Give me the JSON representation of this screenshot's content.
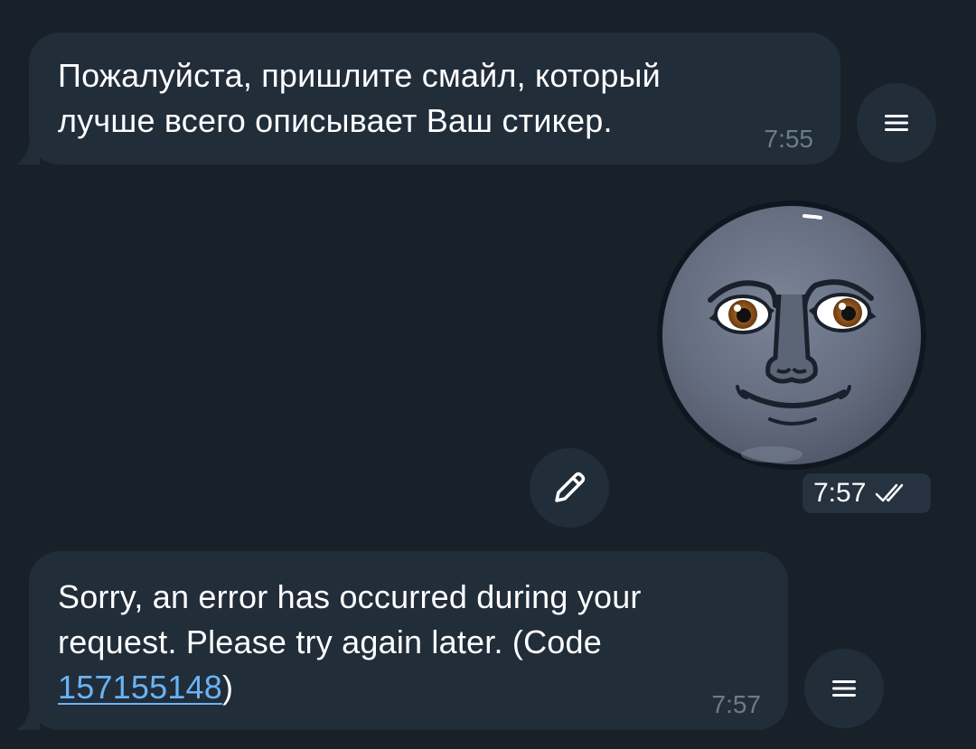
{
  "messages": [
    {
      "text": "Пожалуйста, пришлите смайл, который\nлучше всего описывает Ваш стикер.",
      "time": "7:55"
    },
    {
      "sticker": "new-moon-face-sticker",
      "time": "7:57",
      "status": "read"
    },
    {
      "text_before": "Sorry, an error has occurred during your\nrequest. Please try again later. (Code\n",
      "code": "157155148",
      "text_after": ")",
      "time": "7:57"
    }
  ],
  "icons": {
    "menu": "menu-icon",
    "edit": "pencil-icon",
    "read_status": "double-check-icon"
  },
  "colors": {
    "background": "#182029",
    "bubble": "#222d3a",
    "link": "#6ab3f3"
  }
}
